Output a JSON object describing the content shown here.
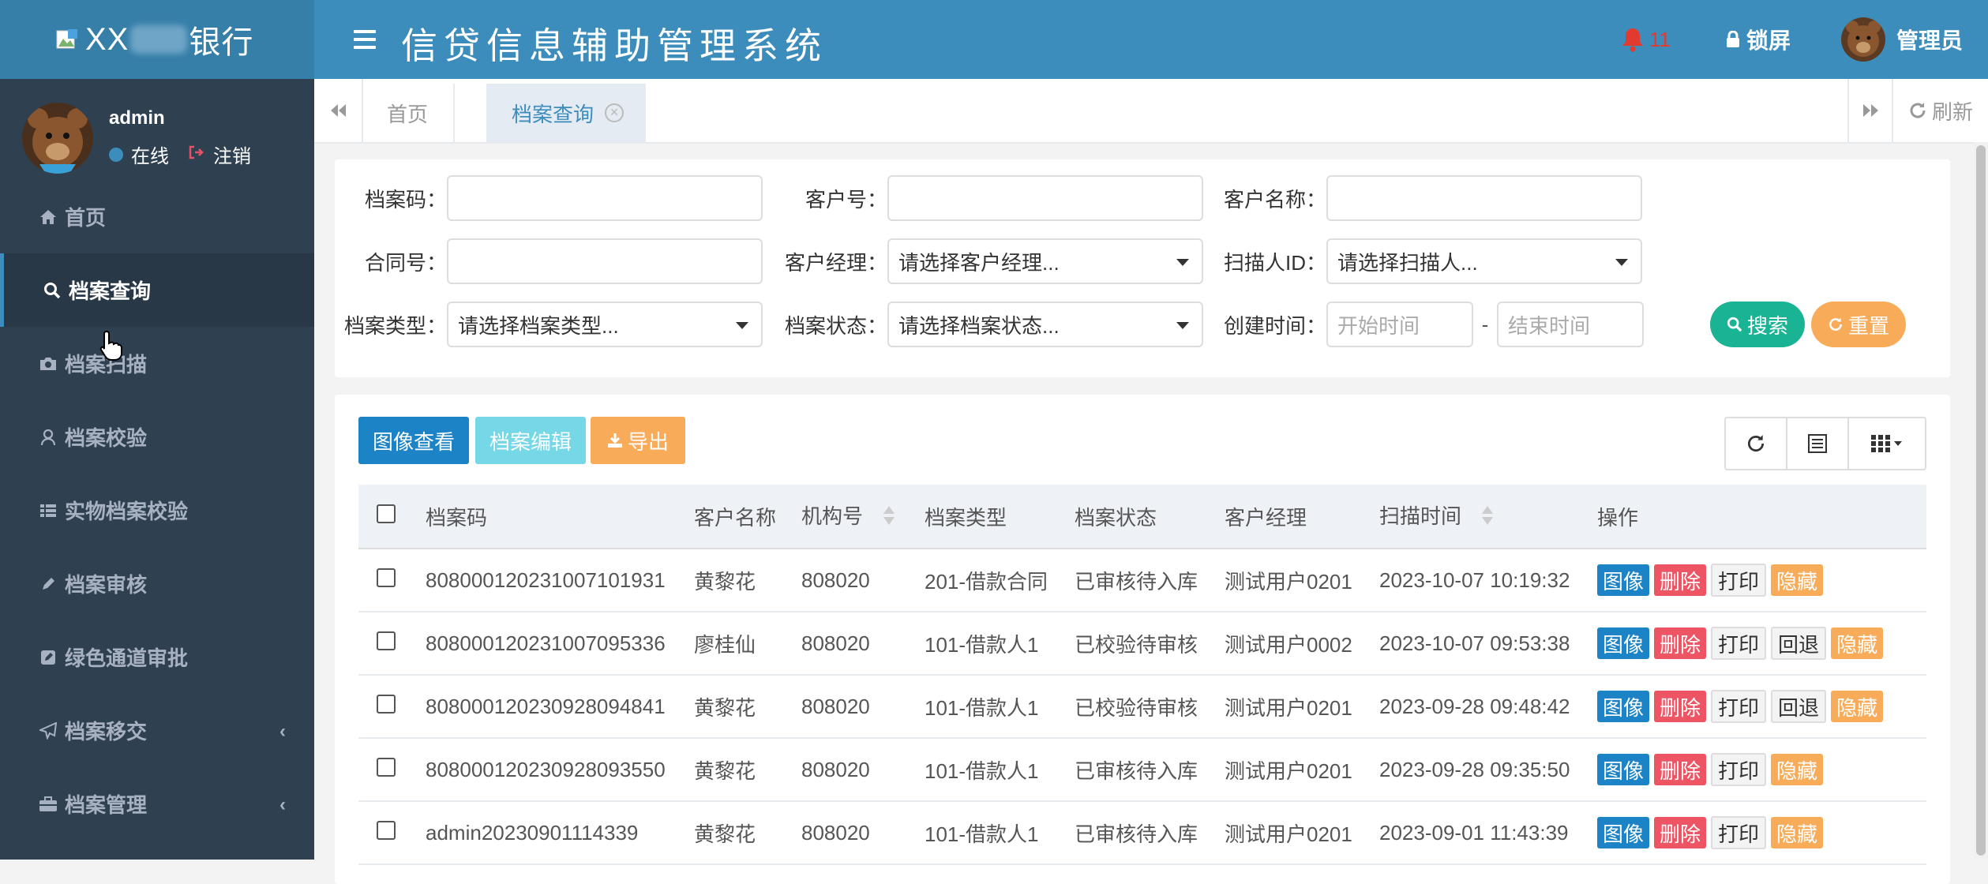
{
  "brand": {
    "prefix": "XX",
    "suffix": "银行"
  },
  "header": {
    "title": "信贷信息辅助管理系统",
    "notifications": "11",
    "lock_label": "锁屏",
    "user_label": "管理员"
  },
  "sidebar": {
    "user": {
      "name": "admin",
      "status": "在线",
      "logout": "注销"
    },
    "items": [
      {
        "label": "首页"
      },
      {
        "label": "档案查询"
      },
      {
        "label": "档案扫描"
      },
      {
        "label": "档案校验"
      },
      {
        "label": "实物档案校验"
      },
      {
        "label": "档案审核"
      },
      {
        "label": "绿色通道审批"
      },
      {
        "label": "档案移交"
      },
      {
        "label": "档案管理"
      }
    ]
  },
  "tabs": {
    "items": [
      {
        "label": "首页"
      },
      {
        "label": "档案查询"
      }
    ],
    "refresh_label": "刷新"
  },
  "search": {
    "archive_code": {
      "label": "档案码：",
      "value": ""
    },
    "customer_no": {
      "label": "客户号：",
      "value": ""
    },
    "customer_name": {
      "label": "客户名称：",
      "value": ""
    },
    "contract_no": {
      "label": "合同号：",
      "value": ""
    },
    "manager": {
      "label": "客户经理：",
      "value": "请选择客户经理..."
    },
    "scanner": {
      "label": "扫描人ID：",
      "value": "请选择扫描人..."
    },
    "archive_type": {
      "label": "档案类型：",
      "value": "请选择档案类型..."
    },
    "archive_status": {
      "label": "档案状态：",
      "value": "请选择档案状态..."
    },
    "created": {
      "label": "创建时间：",
      "start_placeholder": "开始时间",
      "sep": "-",
      "end_placeholder": "结束时间"
    },
    "search_label": "搜索",
    "reset_label": "重置"
  },
  "toolbar": {
    "view_label": "图像查看",
    "edit_label": "档案编辑",
    "export_label": "导出"
  },
  "table": {
    "headers": [
      "档案码",
      "客户名称",
      "机构号",
      "档案类型",
      "档案状态",
      "客户经理",
      "扫描时间",
      "操作"
    ],
    "op_labels": {
      "image": "图像",
      "delete": "删除",
      "print": "打印",
      "back": "回退",
      "hide": "隐藏"
    },
    "rows": [
      {
        "code": "80800012023​1007101931",
        "name": "黄黎花",
        "org": "808020",
        "type": "201-借款合同",
        "status": "已审核待入库",
        "manager": "测试用户0201",
        "time": "2023-10-07 10:19:32",
        "back": false
      },
      {
        "code": "808000120231007095336",
        "name": "廖桂仙",
        "org": "808020",
        "type": "101-借款人1",
        "status": "已校验待审核",
        "manager": "测试用户0002",
        "time": "2023-10-07 09:53:38",
        "back": true
      },
      {
        "code": "808000120230928094841",
        "name": "黄黎花",
        "org": "808020",
        "type": "101-借款人1",
        "status": "已校验待审核",
        "manager": "测试用户0201",
        "time": "2023-09-28 09:48:42",
        "back": true
      },
      {
        "code": "808000120230928093550",
        "name": "黄黎花",
        "org": "808020",
        "type": "101-借款人1",
        "status": "已审核待入库",
        "manager": "测试用户0201",
        "time": "2023-09-28 09:35:50",
        "back": false
      },
      {
        "code": "admin20230901114339",
        "name": "黄黎花",
        "org": "808020",
        "type": "101-借款人1",
        "status": "已审核待入库",
        "manager": "测试用户0201",
        "time": "2023-09-01 11:43:39",
        "back": false
      }
    ]
  }
}
